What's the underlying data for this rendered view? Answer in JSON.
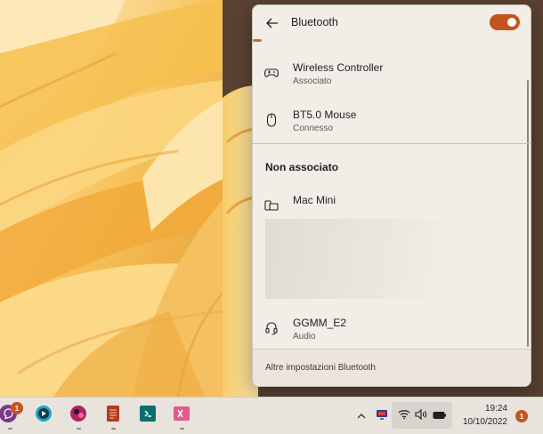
{
  "flyout": {
    "title": "Bluetooth",
    "toggle_on": true,
    "accent_color": "#c4541e",
    "paired_devices": [
      {
        "name": "Wireless Controller",
        "status": "Associato",
        "icon": "gamepad-icon"
      },
      {
        "name": "BT5.0 Mouse",
        "status": "Connesso",
        "icon": "mouse-icon"
      }
    ],
    "unpaired_section_title": "Non associato",
    "unpaired_devices": [
      {
        "name": "Mac Mini",
        "status": "",
        "icon": "computer-icon"
      },
      {
        "name": "GGMM_E2",
        "status": "Audio",
        "icon": "headset-icon"
      }
    ],
    "footer_link": "Altre impostazioni Bluetooth"
  },
  "taskbar": {
    "apps": [
      {
        "name": "WhatsApp",
        "icon": "whatsapp-icon",
        "badge": "1"
      },
      {
        "name": "Media player",
        "icon": "play-icon"
      },
      {
        "name": "Browser",
        "icon": "browser-icon"
      },
      {
        "name": "Notebook",
        "icon": "notebook-icon"
      },
      {
        "name": "Code editor",
        "icon": "code-icon"
      },
      {
        "name": "Excel",
        "icon": "excel-icon"
      }
    ],
    "tray": {
      "icons": [
        "chevron-up-icon",
        "network-display-icon",
        "wifi-icon",
        "volume-icon",
        "battery-icon"
      ]
    },
    "clock": {
      "time": "19:24",
      "date": "10/10/2022"
    },
    "notification_badge": "1"
  }
}
